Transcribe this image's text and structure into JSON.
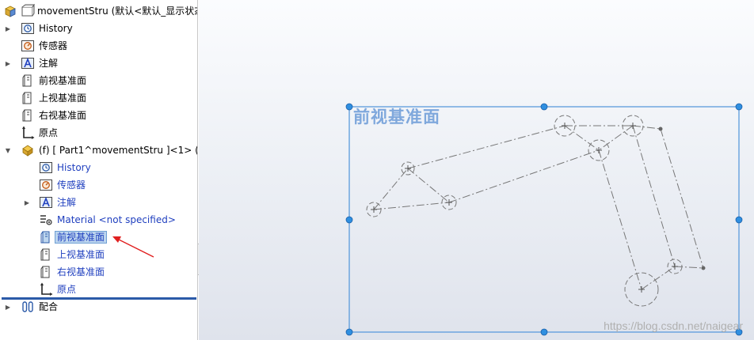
{
  "tree": {
    "root": {
      "label": "movementStru  (默认<默认_显示状态"
    },
    "items": [
      {
        "label": "History"
      },
      {
        "label": "传感器"
      },
      {
        "label": "注解"
      },
      {
        "label": "前视基准面"
      },
      {
        "label": "上视基准面"
      },
      {
        "label": "右视基准面"
      },
      {
        "label": "原点"
      },
      {
        "label": "(f) [ Part1^movementStru ]<1> (默"
      }
    ],
    "sub_items": [
      {
        "label": "History"
      },
      {
        "label": "传感器"
      },
      {
        "label": "注解"
      },
      {
        "label": "Material <not specified>"
      },
      {
        "label": "前视基准面"
      },
      {
        "label": "上视基准面"
      },
      {
        "label": "右视基准面"
      },
      {
        "label": "原点"
      }
    ],
    "mates": {
      "label": "配合"
    }
  },
  "viewport": {
    "plane_label": "前视基准面",
    "watermark": "https://blog.csdn.net/naigear"
  },
  "colors": {
    "selection": "#bcd5ee",
    "sub_text": "#1f3fbf",
    "plane_border": "#5a9bdc",
    "handle": "#2f8fe0",
    "sketch": "#777777",
    "arrow": "#e02020"
  }
}
